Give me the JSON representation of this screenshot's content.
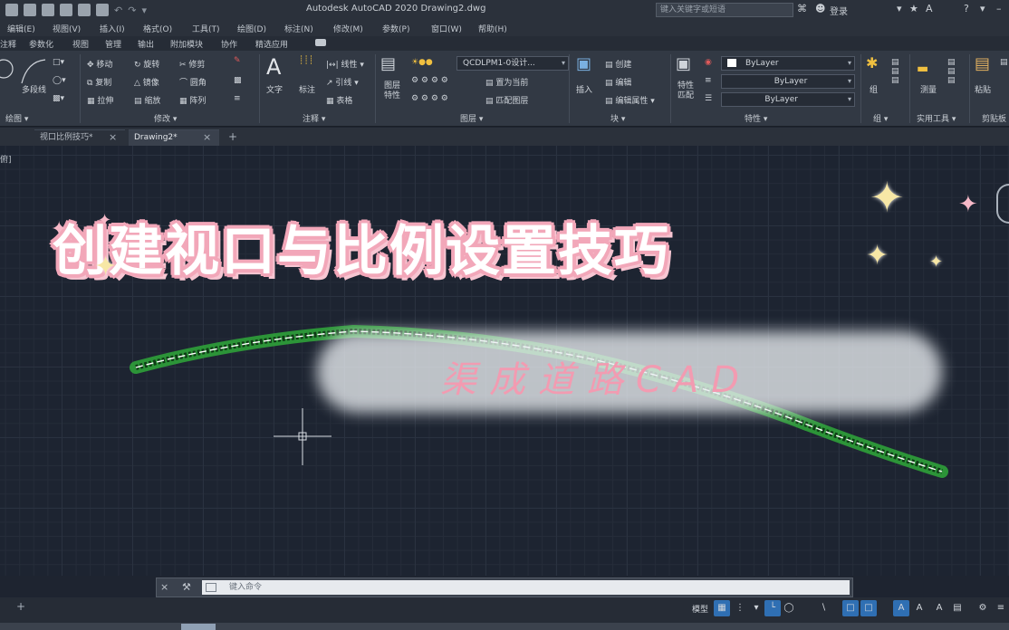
{
  "titlebar": {
    "app_title": "Autodesk AutoCAD 2020    Drawing2.dwg",
    "search_placeholder": "键入关键字或短语",
    "user_label": "登录"
  },
  "menu": [
    {
      "label": "编辑(E)"
    },
    {
      "label": "视图(V)"
    },
    {
      "label": "插入(I)"
    },
    {
      "label": "格式(O)"
    },
    {
      "label": "工具(T)"
    },
    {
      "label": "绘图(D)"
    },
    {
      "label": "标注(N)"
    },
    {
      "label": "修改(M)"
    },
    {
      "label": "参数(P)"
    },
    {
      "label": "窗口(W)"
    },
    {
      "label": "帮助(H)"
    }
  ],
  "ribbon_tabs": [
    {
      "label": "注释"
    },
    {
      "label": "参数化"
    },
    {
      "label": "视图"
    },
    {
      "label": "管理"
    },
    {
      "label": "输出"
    },
    {
      "label": "附加模块"
    },
    {
      "label": "协作"
    },
    {
      "label": "精选应用"
    }
  ],
  "ribbon": {
    "draw_labels": {
      "polyline": "多段线"
    },
    "modify_labels": {
      "move": "移动",
      "rotate": "旋转",
      "trim": "修剪",
      "copy": "复制",
      "mirror": "镜像",
      "fillet": "圆角",
      "stretch": "拉伸",
      "scale": "缩放",
      "array": "阵列"
    },
    "annotation_labels": {
      "text": "文字",
      "dimension": "标注",
      "linear": "线性",
      "leader": "引线",
      "table": "表格"
    },
    "layer_labels": {
      "layer_props": "图层\n特性",
      "current_layer": "QCDLPM1-0设计...",
      "set_current": "置为当前",
      "match_layer": "匹配图层"
    },
    "block_labels": {
      "insert": "插入",
      "create": "创建",
      "edit": "编辑",
      "edit_attr": "编辑属性"
    },
    "property_labels": {
      "match": "特性\n匹配",
      "bylayer_color": "ByLayer",
      "bylayer_linetype": "ByLayer",
      "bylayer_lineweight": "ByLayer"
    },
    "group_labels": {
      "group": "组"
    },
    "utility_labels": {
      "measure": "测量"
    },
    "clipboard_labels": {
      "paste": "粘贴"
    },
    "panel_footers": {
      "draw": "绘图",
      "modify": "修改",
      "annotation": "注释",
      "layers": "图层",
      "block": "块",
      "properties": "特性",
      "groups": "组",
      "utilities": "实用工具",
      "clipboard": "剪贴板"
    }
  },
  "doc_tabs": [
    {
      "label": "视口比例技巧*",
      "active": false
    },
    {
      "label": "Drawing2*",
      "active": true
    }
  ],
  "canvas": {
    "viewport_label": "俯]",
    "headline": "创建视口与比例设置技巧",
    "subtitle": "渠成道路CAD"
  },
  "command_line": {
    "placeholder": "键入命令"
  },
  "statusbar": {
    "model_label": "模型"
  },
  "colors": {
    "accent_pink": "#f2a7b9",
    "subtitle_pink": "#f29bb1",
    "road_green": "#2fa83a",
    "status_on_blue": "#2f6fb3"
  }
}
